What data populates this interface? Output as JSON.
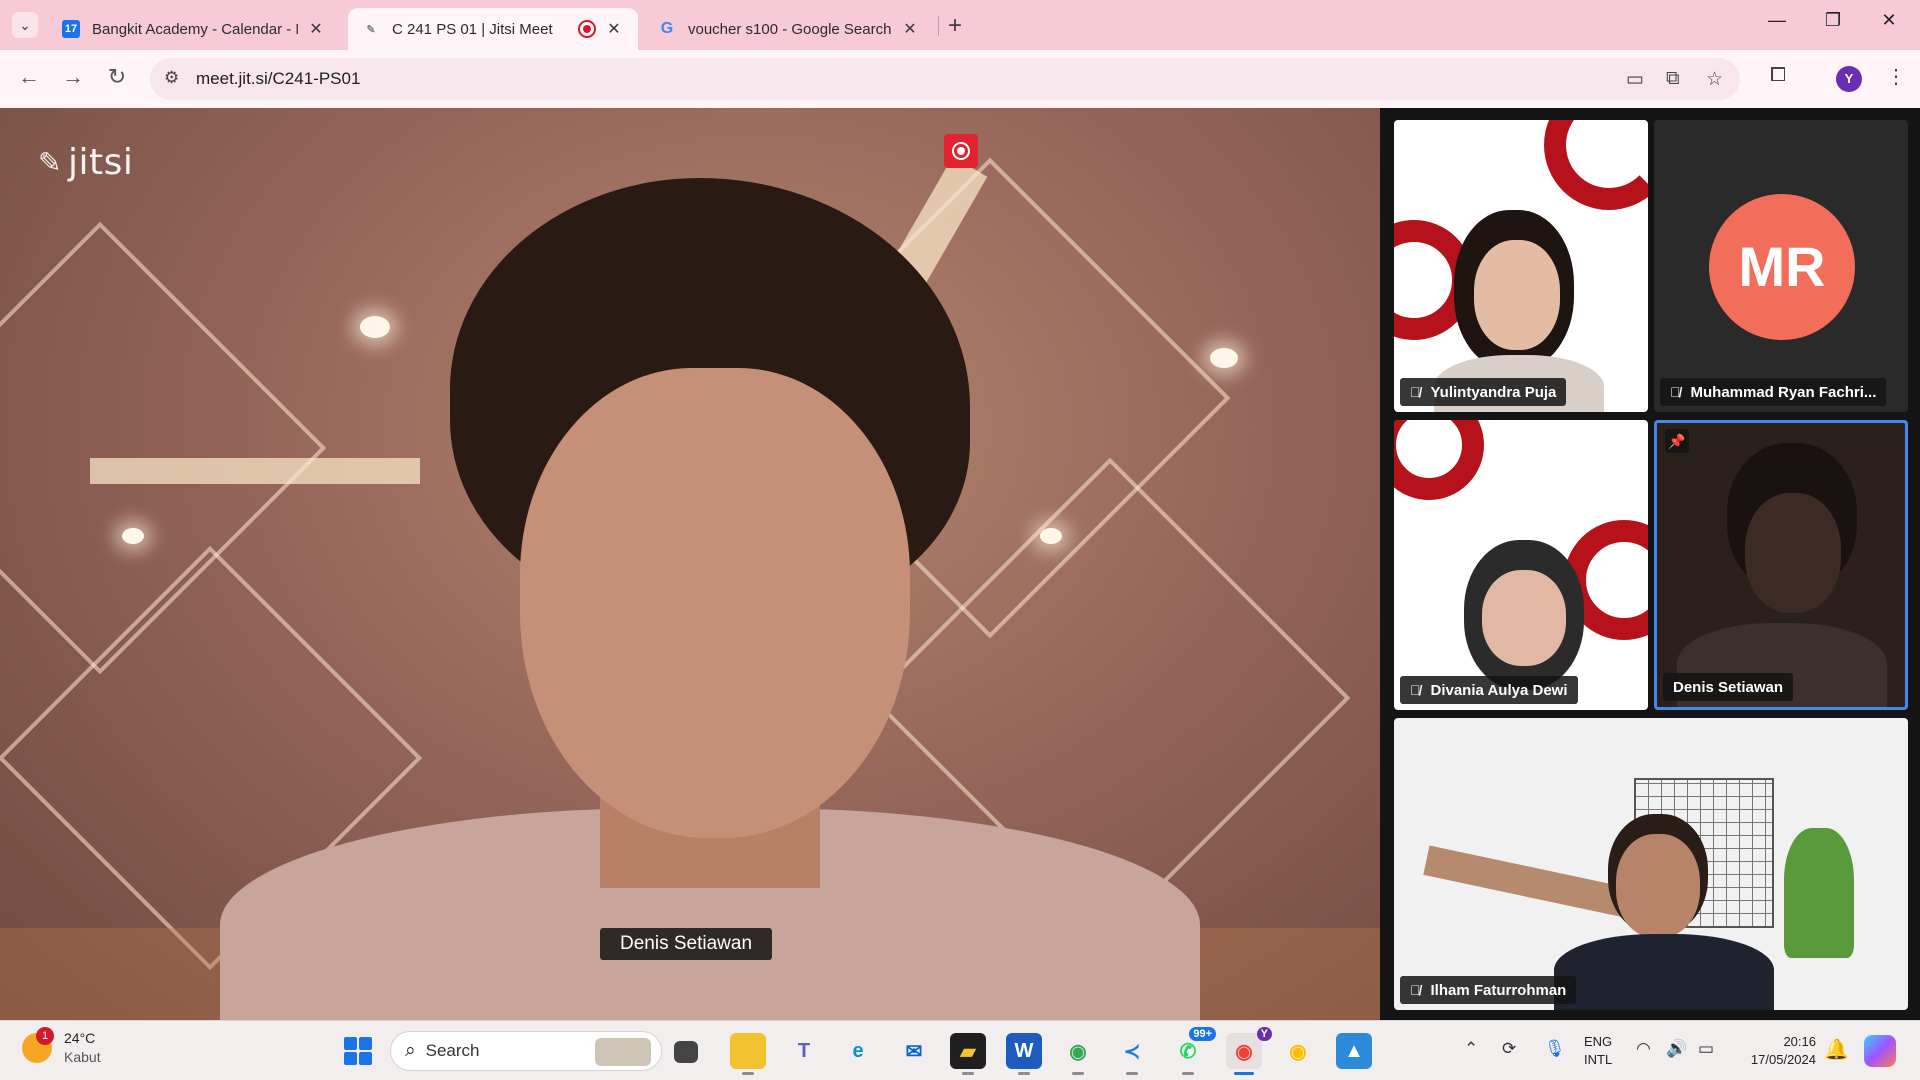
{
  "browser": {
    "tabs": [
      {
        "title": "Bangkit Academy - Calendar - M",
        "favicon": "calendar-17-icon",
        "active": false
      },
      {
        "title": "C 241 PS 01 | Jitsi Meet",
        "favicon": "jitsi-icon",
        "active": true,
        "recording": true
      },
      {
        "title": "voucher s100 - Google Search",
        "favicon": "google-icon",
        "active": false
      }
    ],
    "url": "meet.jit.si/C241-PS01",
    "profile_initial": "Y"
  },
  "meeting": {
    "logo": "jitsi",
    "main_speaker": "Denis Setiawan",
    "participants": [
      {
        "name": "Yulintyandra Puja",
        "muted": true
      },
      {
        "name": "Muhammad Ryan Fachri...",
        "muted": true,
        "avatar_initials": "MR",
        "avatar_color": "#f26e5a"
      },
      {
        "name": "Divania Aulya Dewi",
        "muted": true
      },
      {
        "name": "Denis Setiawan",
        "muted": false,
        "pinned": true,
        "highlight_color": "#4687ed"
      },
      {
        "name": "Ilham Faturrohman",
        "muted": true
      }
    ],
    "recording_color": "#e0232f"
  },
  "taskbar": {
    "weather": {
      "temp": "24°C",
      "condition": "Kabut",
      "badge": "1"
    },
    "search_label": "Search",
    "whatsapp_badge": "99+",
    "chrome_badge": "Y",
    "language": {
      "line1": "ENG",
      "line2": "INTL"
    },
    "clock": {
      "time": "20:16",
      "date": "17/05/2024"
    }
  }
}
